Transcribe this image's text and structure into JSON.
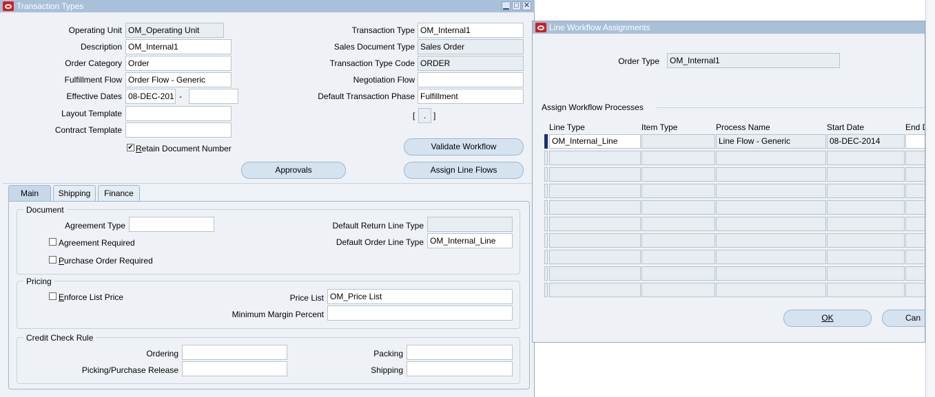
{
  "win1": {
    "title": "Transaction Types",
    "left_fields": [
      {
        "label": "Operating Unit",
        "value": "OM_Operating Unit"
      },
      {
        "label": "Description",
        "value": "OM_Internal1"
      },
      {
        "label": "Order Category",
        "value": "Order"
      },
      {
        "label": "Fulfillment Flow",
        "value": "Order Flow - Generic"
      },
      {
        "label": "Effective Dates",
        "value": "08-DEC-201",
        "value2": "",
        "separator": "-"
      },
      {
        "label": "Layout Template",
        "value": ""
      },
      {
        "label": "Contract Template",
        "value": ""
      }
    ],
    "right_fields": [
      {
        "label": "Transaction Type",
        "value": "OM_Internal1"
      },
      {
        "label": "Sales Document Type",
        "value": "Sales Order"
      },
      {
        "label": "Transaction Type Code",
        "value": "ORDER"
      },
      {
        "label": "Negotiation Flow",
        "value": ""
      },
      {
        "label": "Default Transaction Phase",
        "value": "Fulfillment"
      }
    ],
    "bracket_field": {
      "left": "[",
      "value": ".",
      "right": "]"
    },
    "retain_doc": {
      "label": "Retain Document Number",
      "checked": true,
      "checkmark": "✔"
    },
    "buttons": {
      "validate": "Validate Workflow",
      "approvals": "Approvals",
      "assign": "Assign Line  Flows"
    },
    "tabs": [
      "Main",
      "Shipping",
      "Finance"
    ],
    "document": {
      "title": "Document",
      "agreement_type_label": "Agreement Type",
      "agreement_type_value": "",
      "agreement_required": "Agreement Required",
      "po_required": "Purchase Order Required",
      "default_return_label": "Default Return Line Type",
      "default_return_value": "",
      "default_order_label": "Default Order Line Type",
      "default_order_value": "OM_Internal_Line"
    },
    "pricing": {
      "title": "Pricing",
      "enforce": "Enforce List Price",
      "price_list_label": "Price List",
      "price_list_value": "OM_Price List",
      "min_margin_label": "Minimum Margin Percent",
      "min_margin_value": ""
    },
    "credit": {
      "title": "Credit Check Rule",
      "ordering": "Ordering",
      "picking": "Picking/Purchase Release",
      "packing": "Packing",
      "shipping": "Shipping"
    }
  },
  "win2": {
    "title": "Line Workflow Assignments",
    "order_type_label": "Order Type",
    "order_type_value": "OM_Internal1",
    "section_title": "Assign Workflow Processes",
    "columns": [
      "Line Type",
      "Item Type",
      "Process Name",
      "Start Date",
      "End D"
    ],
    "rows": [
      [
        "OM_Internal_Line",
        "",
        "Line Flow - Generic",
        "08-DEC-2014",
        ""
      ],
      [
        "",
        "",
        "",
        "",
        ""
      ],
      [
        "",
        "",
        "",
        "",
        ""
      ],
      [
        "",
        "",
        "",
        "",
        ""
      ],
      [
        "",
        "",
        "",
        "",
        ""
      ],
      [
        "",
        "",
        "",
        "",
        ""
      ],
      [
        "",
        "",
        "",
        "",
        ""
      ],
      [
        "",
        "",
        "",
        "",
        ""
      ],
      [
        "",
        "",
        "",
        "",
        ""
      ],
      [
        "",
        "",
        "",
        "",
        ""
      ]
    ],
    "ok": "OK",
    "cancel": "Can"
  },
  "colors": {
    "title_bar": "#a9c0d9",
    "button": "#d5e2f0",
    "window_bg": "#eef2f6",
    "oracle_red": "#d11f1f",
    "current_row": "#1a2f6e"
  },
  "icons": [
    "oracle-logo-icon",
    "minimize-icon",
    "maximize-icon",
    "close-icon",
    "checkbox-icon"
  ]
}
